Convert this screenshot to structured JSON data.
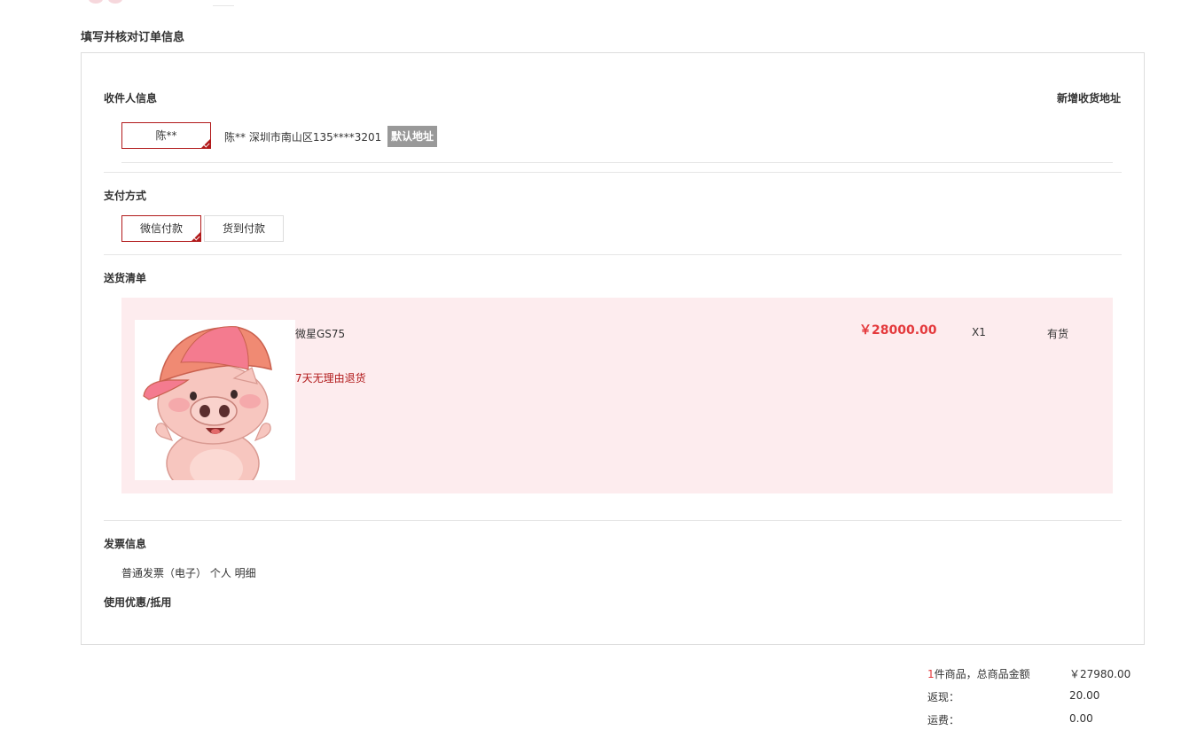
{
  "page_title": "填写并核对订单信息",
  "receiver": {
    "section_title": "收件人信息",
    "add_address_link": "新增收货地址",
    "selected_name": "陈**",
    "address_detail": "陈** 深圳市南山区135****3201",
    "default_tag": "默认地址"
  },
  "payment": {
    "section_title": "支付方式",
    "options": [
      {
        "label": "微信付款",
        "selected": true
      },
      {
        "label": "货到付款",
        "selected": false
      }
    ]
  },
  "delivery": {
    "section_title": "送货清单",
    "item": {
      "name": "微星GS75",
      "service": "7天无理由退货",
      "price": "￥28000.00",
      "quantity": "X1",
      "stock": "有货",
      "image": "pig-cartoon-with-pink-cap"
    }
  },
  "invoice": {
    "section_title": "发票信息",
    "detail": "普通发票（电子） 个人 明细"
  },
  "coupon": {
    "section_title": "使用优惠/抵用"
  },
  "summary": {
    "item_count": "1",
    "item_count_suffix": "件商品，总商品金额",
    "total_amount": "￥27980.00",
    "cashback_label": "返现：",
    "cashback_value": "20.00",
    "shipping_label": "运费：",
    "shipping_value": "0.00"
  },
  "colors": {
    "accent_red": "#b1191a",
    "price_red": "#e4393c",
    "goods_bg": "#fdecee",
    "tag_gray": "#999999"
  }
}
